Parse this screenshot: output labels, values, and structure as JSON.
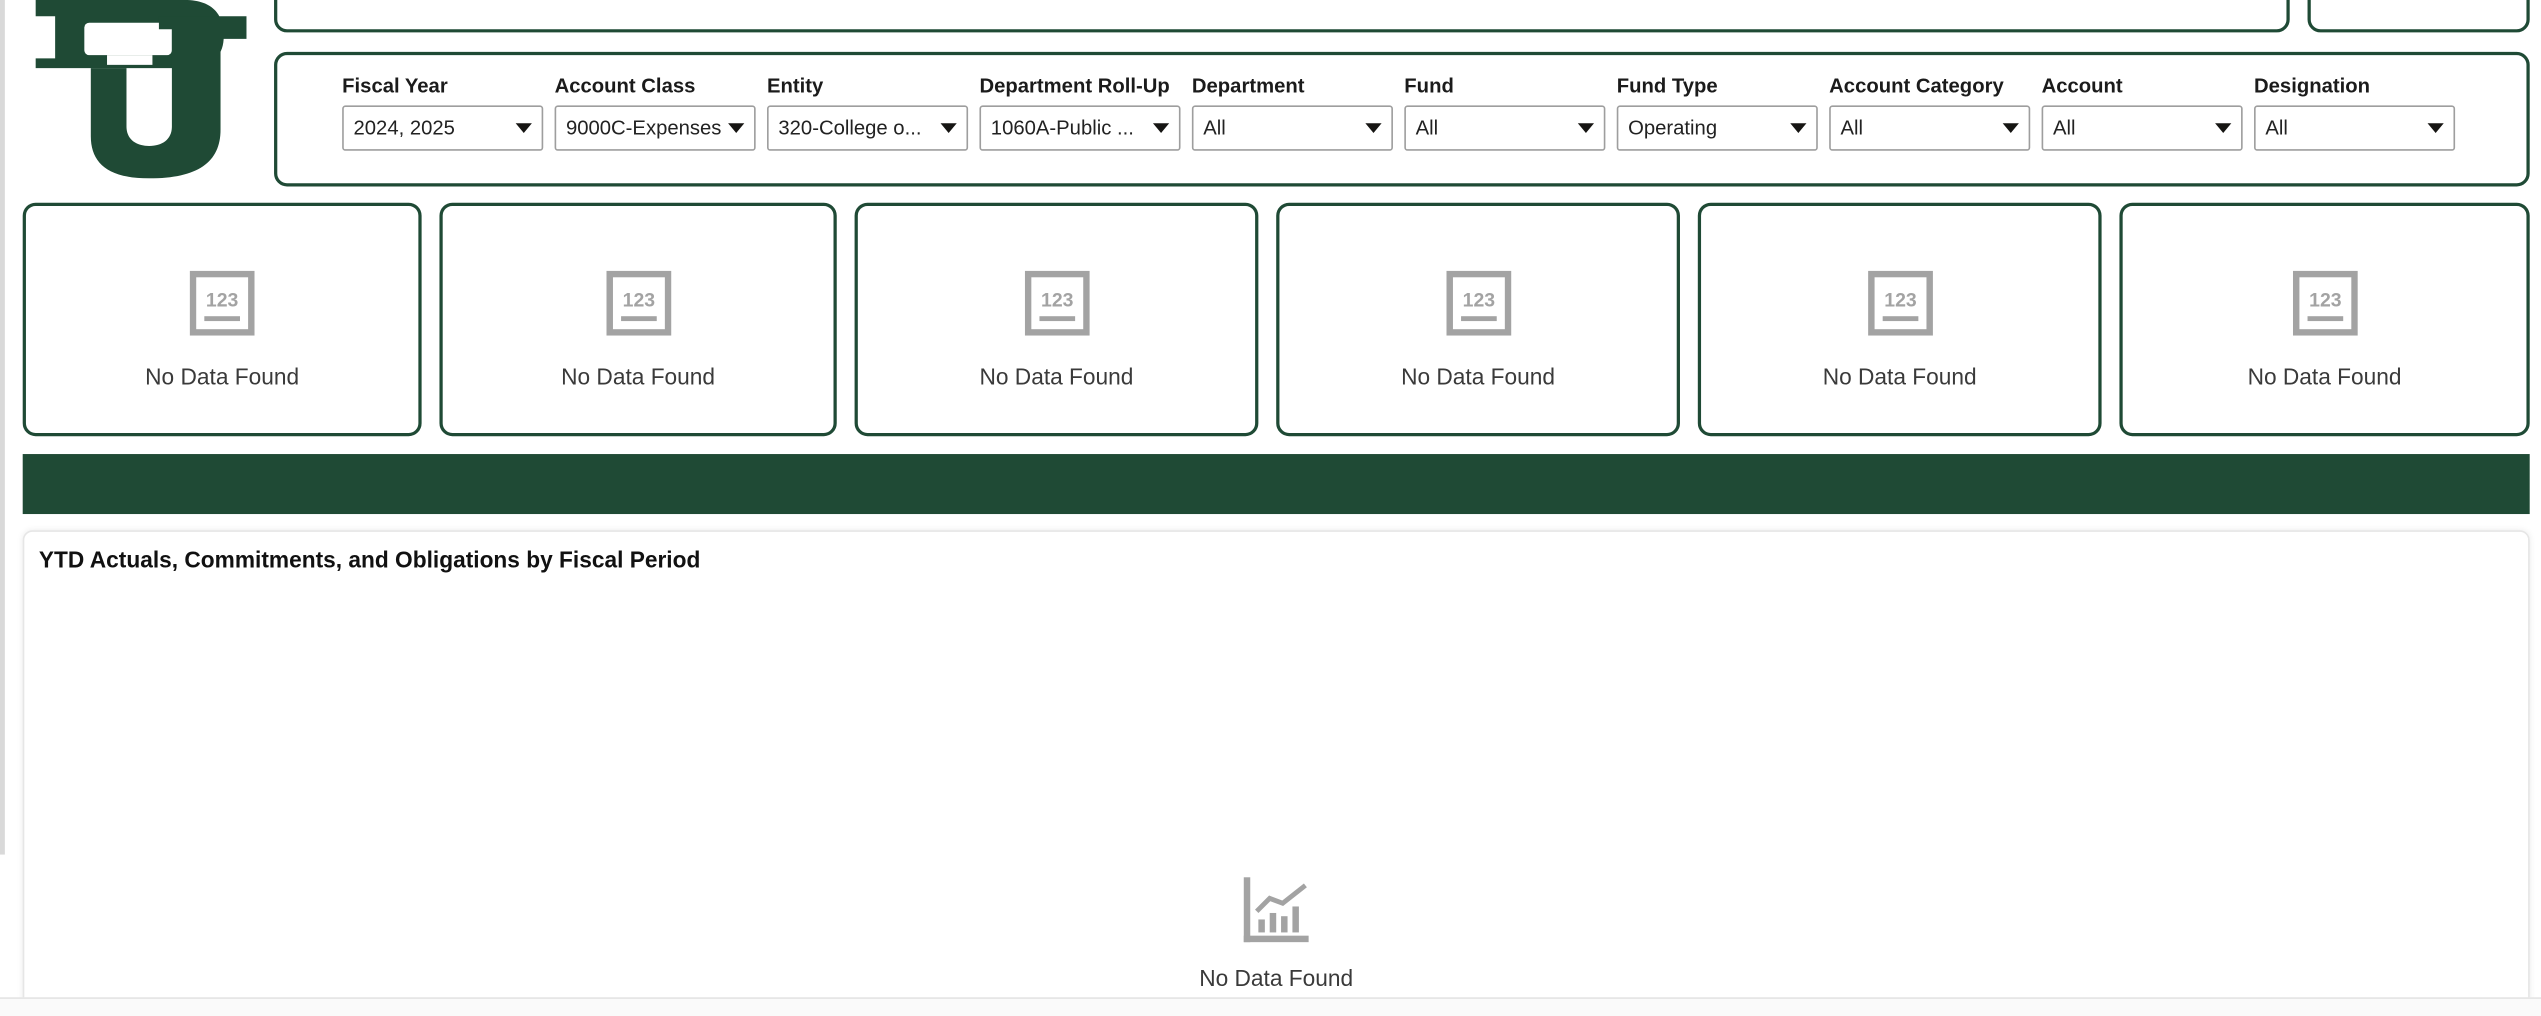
{
  "brand": {
    "primary_color": "#1f4a35",
    "logo": "bu-logo"
  },
  "filters": [
    {
      "label": "Fiscal Year",
      "value": "2024, 2025"
    },
    {
      "label": "Account Class",
      "value": "9000C-Expenses"
    },
    {
      "label": "Entity",
      "value": "320-College o..."
    },
    {
      "label": "Department Roll-Up",
      "value": "1060A-Public ..."
    },
    {
      "label": "Department",
      "value": "All"
    },
    {
      "label": "Fund",
      "value": "All"
    },
    {
      "label": "Fund Type",
      "value": "Operating"
    },
    {
      "label": "Account Category",
      "value": "All"
    },
    {
      "label": "Account",
      "value": "All"
    },
    {
      "label": "Designation",
      "value": "All"
    }
  ],
  "kpi_tiles": [
    {
      "icon": "number-tile-icon",
      "message": "No Data Found"
    },
    {
      "icon": "number-tile-icon",
      "message": "No Data Found"
    },
    {
      "icon": "number-tile-icon",
      "message": "No Data Found"
    },
    {
      "icon": "number-tile-icon",
      "message": "No Data Found"
    },
    {
      "icon": "number-tile-icon",
      "message": "No Data Found"
    },
    {
      "icon": "number-tile-icon",
      "message": "No Data Found"
    }
  ],
  "chart_panel": {
    "title": "YTD Actuals, Commitments, and Obligations by Fiscal Period",
    "empty_icon": "bar-chart-icon",
    "empty_message": "No Data Found"
  }
}
